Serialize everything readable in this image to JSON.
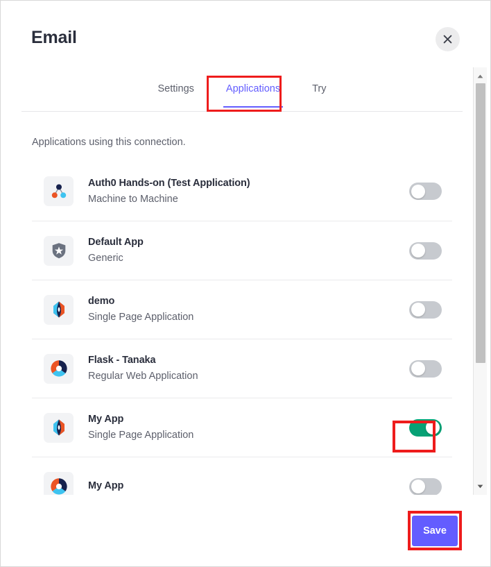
{
  "modal": {
    "title": "Email",
    "close_icon": "close-icon"
  },
  "tabs": [
    {
      "label": "Settings",
      "active": false
    },
    {
      "label": "Applications",
      "active": true
    },
    {
      "label": "Try",
      "active": false
    }
  ],
  "body": {
    "subtitle": "Applications using this connection."
  },
  "applications": [
    {
      "name": "Auth0 Hands-on (Test Application)",
      "type": "Machine to Machine",
      "icon": "molecule-icon",
      "enabled": false
    },
    {
      "name": "Default App",
      "type": "Generic",
      "icon": "auth0-shield-icon",
      "enabled": false
    },
    {
      "name": "demo",
      "type": "Single Page Application",
      "icon": "diamond-icon",
      "enabled": false
    },
    {
      "name": "Flask - Tanaka",
      "type": "Regular Web Application",
      "icon": "pinwheel-icon",
      "enabled": false
    },
    {
      "name": "My App",
      "type": "Single Page Application",
      "icon": "diamond-icon",
      "enabled": true
    },
    {
      "name": "My App",
      "type": "",
      "icon": "pinwheel-icon",
      "enabled": false
    }
  ],
  "footer": {
    "save_label": "Save"
  },
  "scrollbar": {
    "up_icon": "caret-up-icon",
    "down_icon": "caret-down-icon"
  },
  "colors": {
    "accent": "#635dff",
    "toggle_on": "#07a175",
    "toggle_off": "#c7cacf",
    "annotation": "#ee1c1c",
    "text_primary": "#2a2e3c",
    "text_secondary": "#5c5f6b"
  }
}
